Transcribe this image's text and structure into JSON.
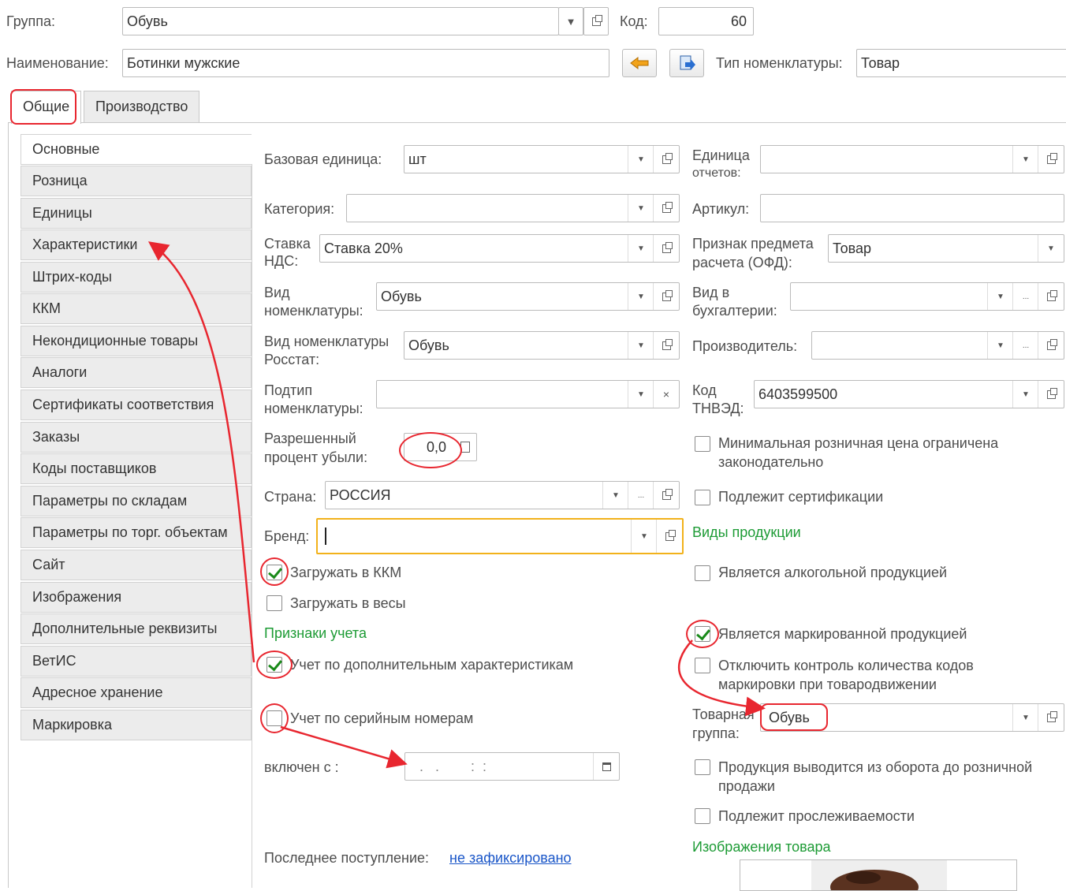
{
  "header": {
    "group_label": "Группа:",
    "group_value": "Обувь",
    "code_label": "Код:",
    "code_value": "60",
    "name_label": "Наименование:",
    "name_value": "Ботинки мужские",
    "type_label": "Тип номенклатуры:",
    "type_value": "Товар"
  },
  "tabs": [
    {
      "label": "Общие"
    },
    {
      "label": "Производство"
    }
  ],
  "sidebar": {
    "items": [
      {
        "label": "Основные"
      },
      {
        "label": "Розница"
      },
      {
        "label": "Единицы"
      },
      {
        "label": "Характеристики"
      },
      {
        "label": "Штрих-коды"
      },
      {
        "label": "ККМ"
      },
      {
        "label": "Некондиционные товары"
      },
      {
        "label": "Аналоги"
      },
      {
        "label": "Сертификаты соответствия"
      },
      {
        "label": "Заказы"
      },
      {
        "label": "Коды поставщиков"
      },
      {
        "label": "Параметры по складам"
      },
      {
        "label": "Параметры по торг. объектам"
      },
      {
        "label": "Сайт"
      },
      {
        "label": "Изображения"
      },
      {
        "label": "Дополнительные реквизиты"
      },
      {
        "label": "ВетИС"
      },
      {
        "label": "Адресное хранение"
      },
      {
        "label": "Маркировка"
      }
    ]
  },
  "left": {
    "base_unit_label": "Базовая единица:",
    "base_unit_value": "шт",
    "category_label": "Категория:",
    "category_value": "",
    "vat_label_1": "Ставка",
    "vat_label_2": "НДС:",
    "vat_value": "Ставка 20%",
    "kind_label_1": "Вид",
    "kind_label_2": "номенклатуры:",
    "kind_value": "Обувь",
    "rosstat_label_1": "Вид номенклатуры",
    "rosstat_label_2": "Росстат:",
    "rosstat_value": "Обувь",
    "subtype_label_1": "Подтип",
    "subtype_label_2": "номенклатуры:",
    "subtype_value": "",
    "loss_label_1": "Разрешенный",
    "loss_label_2": "процент убыли:",
    "loss_value": "0,0",
    "country_label": "Страна:",
    "country_value": "РОССИЯ",
    "brand_label": "Бренд:",
    "brand_value": "",
    "load_kkm": "Загружать в ККМ",
    "load_scales": "Загружать в весы",
    "accounting_header": "Признаки учета",
    "extra_chars": "Учет по дополнительным характеристикам",
    "serial_numbers": "Учет по серийным номерам",
    "enabled_from_label": "включен с :",
    "enabled_from_value": ".   .        :  :",
    "last_receipt_label": "Последнее поступление:",
    "last_receipt_value": "не зафиксировано"
  },
  "right": {
    "report_unit_label_1": "Единица",
    "report_unit_label_2": "отчетов:",
    "report_unit_value": "",
    "article_label": "Артикул:",
    "article_value": "",
    "subject_label_1": "Признак предмета",
    "subject_label_2": "расчета (ОФД):",
    "subject_value": "Товар",
    "acc_kind_label_1": "Вид в",
    "acc_kind_label_2": "бухгалтерии:",
    "acc_kind_value": "",
    "producer_label": "Производитель:",
    "producer_value": "",
    "tnved_label_1": "Код",
    "tnved_label_2": "ТНВЭД:",
    "tnved_value": "6403599500",
    "min_price_1": "Минимальная розничная цена ограничена",
    "min_price_2": "законодательно",
    "certification": "Подлежит сертификации",
    "products_header": "Виды продукции",
    "alcohol": "Является алкогольной продукцией",
    "marked": "Является маркированной продукцией",
    "disable_control_1": "Отключить контроль количества кодов",
    "disable_control_2": "маркировки при товародвижении",
    "goods_group_label_1": "Товарная",
    "goods_group_label_2": "группа:",
    "goods_group_value": "Обувь",
    "withdrawn_1": "Продукция выводится из оборота до розничной",
    "withdrawn_2": "продажи",
    "traceable": "Подлежит прослеживаемости",
    "images_header": "Изображения товара"
  },
  "colors": {
    "annotation": "#e8262f",
    "section_header": "#1d9b35",
    "link": "#1a56c8",
    "brand_focus": "#f2b21b",
    "checkmark": "#1a8a1a"
  },
  "checkboxes": {
    "load_kkm": true,
    "load_scales": false,
    "extra_chars": true,
    "serial_numbers": false,
    "min_price": false,
    "certification": false,
    "alcohol": false,
    "marked": true,
    "disable_control": false,
    "withdrawn": false,
    "traceable": false
  }
}
